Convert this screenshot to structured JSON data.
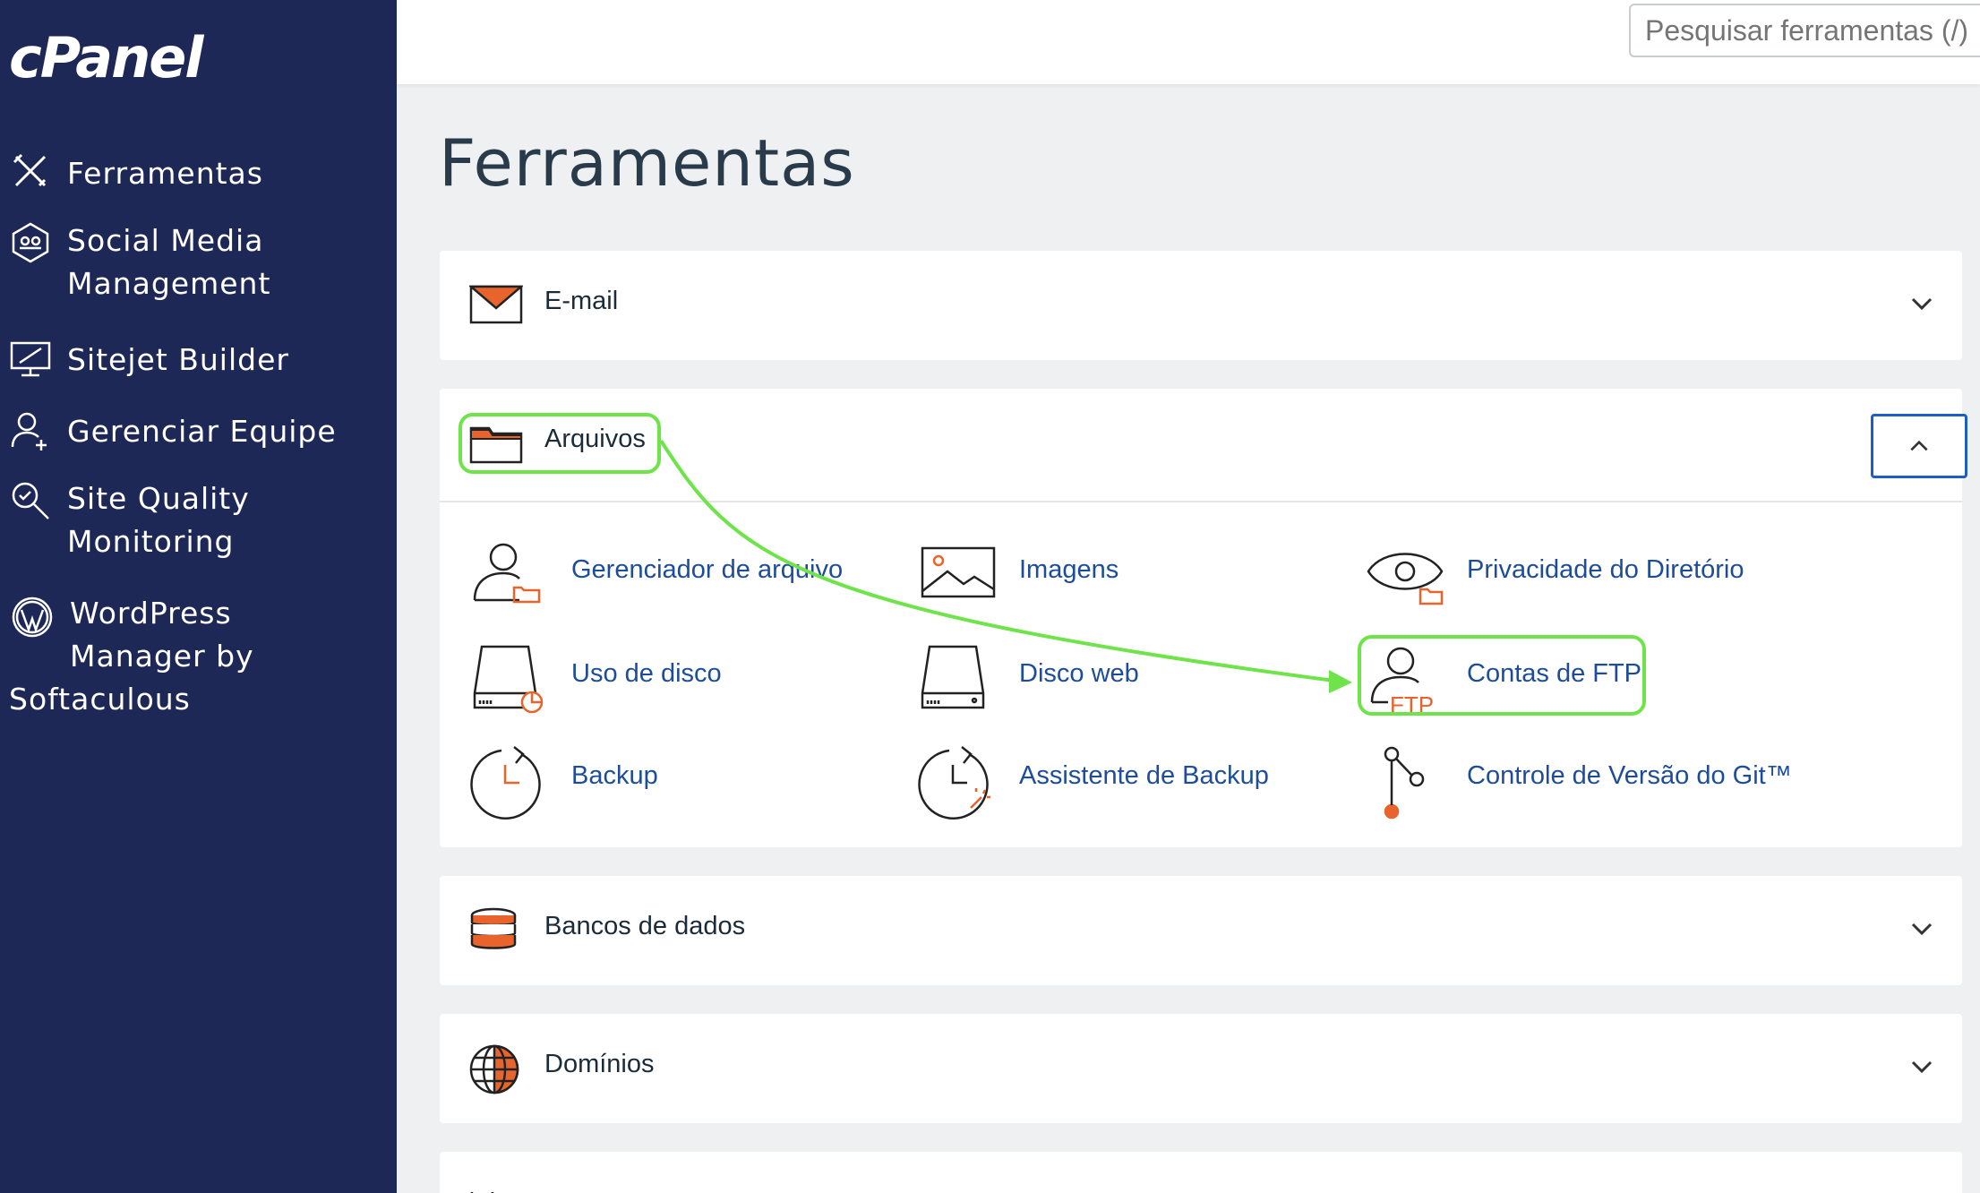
{
  "app": {
    "logo": "cPanel"
  },
  "sidebar": {
    "items": [
      {
        "label": "Ferramentas",
        "icon": "tools-icon"
      },
      {
        "label": "Social Media\nManagement",
        "icon": "social-media-icon"
      },
      {
        "label": "Sitejet Builder",
        "icon": "sitejet-icon"
      },
      {
        "label": "Gerenciar Equipe",
        "icon": "team-icon"
      },
      {
        "label": "Site Quality\nMonitoring",
        "icon": "site-quality-icon"
      },
      {
        "label": "WordPress\n Manager by",
        "label_extra": "Softaculous",
        "icon": "wordpress-icon"
      }
    ]
  },
  "search": {
    "placeholder": "Pesquisar ferramentas (/)"
  },
  "main": {
    "title": "Ferramentas",
    "sections": [
      {
        "title": "E-mail",
        "expanded": false
      },
      {
        "title": "Arquivos",
        "expanded": true,
        "tools": [
          {
            "label": "Gerenciador de arquivo",
            "icon": "file-manager-icon"
          },
          {
            "label": "Imagens",
            "icon": "images-icon"
          },
          {
            "label": "Privacidade do Diretório",
            "icon": "directory-privacy-icon"
          },
          {
            "label": "Uso de disco",
            "icon": "disk-usage-icon"
          },
          {
            "label": "Disco web",
            "icon": "web-disk-icon"
          },
          {
            "label": "Contas de FTP",
            "icon": "ftp-accounts-icon"
          },
          {
            "label": "Backup",
            "icon": "backup-icon"
          },
          {
            "label": "Assistente de Backup",
            "icon": "backup-wizard-icon"
          },
          {
            "label": "Controle de Versão do Git™",
            "icon": "git-icon"
          }
        ]
      },
      {
        "title": "Bancos de dados",
        "expanded": false
      },
      {
        "title": "Domínios",
        "expanded": false
      }
    ]
  },
  "annotation": {
    "highlight_color": "#6fe44a",
    "from": "Arquivos",
    "to": "Contas de FTP"
  },
  "colors": {
    "sidebar": "#1e2856",
    "link": "#1d4d9a",
    "accent_orange": "#e8642c",
    "button_border": "#1b5ec7"
  }
}
